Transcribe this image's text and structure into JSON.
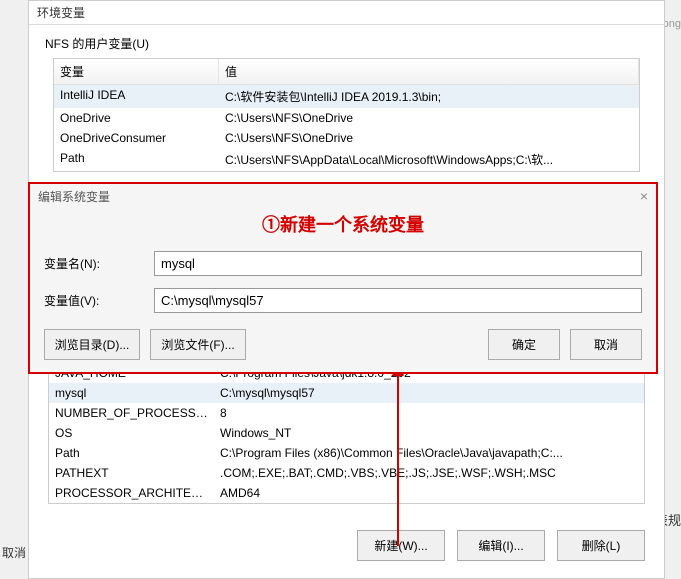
{
  "mainWindow": {
    "title": "环境变量"
  },
  "userSection": {
    "label": "NFS 的用户变量(U)",
    "headers": {
      "var": "变量",
      "val": "值"
    },
    "rows": [
      {
        "var": "IntelliJ IDEA",
        "val": "C:\\软件安装包\\IntelliJ IDEA 2019.1.3\\bin;",
        "hl": true
      },
      {
        "var": "OneDrive",
        "val": "C:\\Users\\NFS\\OneDrive",
        "hl": false
      },
      {
        "var": "OneDriveConsumer",
        "val": "C:\\Users\\NFS\\OneDrive",
        "hl": false
      },
      {
        "var": "Path",
        "val": "C:\\Users\\NFS\\AppData\\Local\\Microsoft\\WindowsApps;C:\\软...",
        "hl": false
      }
    ]
  },
  "dialog": {
    "title": "编辑系统变量",
    "annotation": "①新建一个系统变量",
    "nameLabel": "变量名(N):",
    "nameValue": "mysql",
    "valueLabel": "变量值(V):",
    "valueValue": "C:\\mysql\\mysql57",
    "browseDir": "浏览目录(D)...",
    "browseFile": "浏览文件(F)...",
    "ok": "确定",
    "cancel": "取消"
  },
  "sysSection": {
    "rows": [
      {
        "var": "JAVA_HOME",
        "val": "C:\\Program Files\\Java\\jdk1.8.0_202",
        "hl": false
      },
      {
        "var": "mysql",
        "val": "C:\\mysql\\mysql57",
        "hl": true
      },
      {
        "var": "NUMBER_OF_PROCESSORS",
        "val": "8",
        "hl": false
      },
      {
        "var": "OS",
        "val": "Windows_NT",
        "hl": false
      },
      {
        "var": "Path",
        "val": "C:\\Program Files (x86)\\Common Files\\Oracle\\Java\\javapath;C:...",
        "hl": false
      },
      {
        "var": "PATHEXT",
        "val": ".COM;.EXE;.BAT;.CMD;.VBS;.VBE;.JS;.JSE;.WSF;.WSH;.MSC",
        "hl": false
      },
      {
        "var": "PROCESSOR_ARCHITECTU...",
        "val": "AMD64",
        "hl": false
      }
    ]
  },
  "bottomButtons": {
    "new": "新建(W)...",
    "edit": "编辑(I)...",
    "delete": "删除(L)"
  },
  "bg": {
    "t1": "ong",
    "t2": "表规"
  },
  "outerCancel": "取消"
}
